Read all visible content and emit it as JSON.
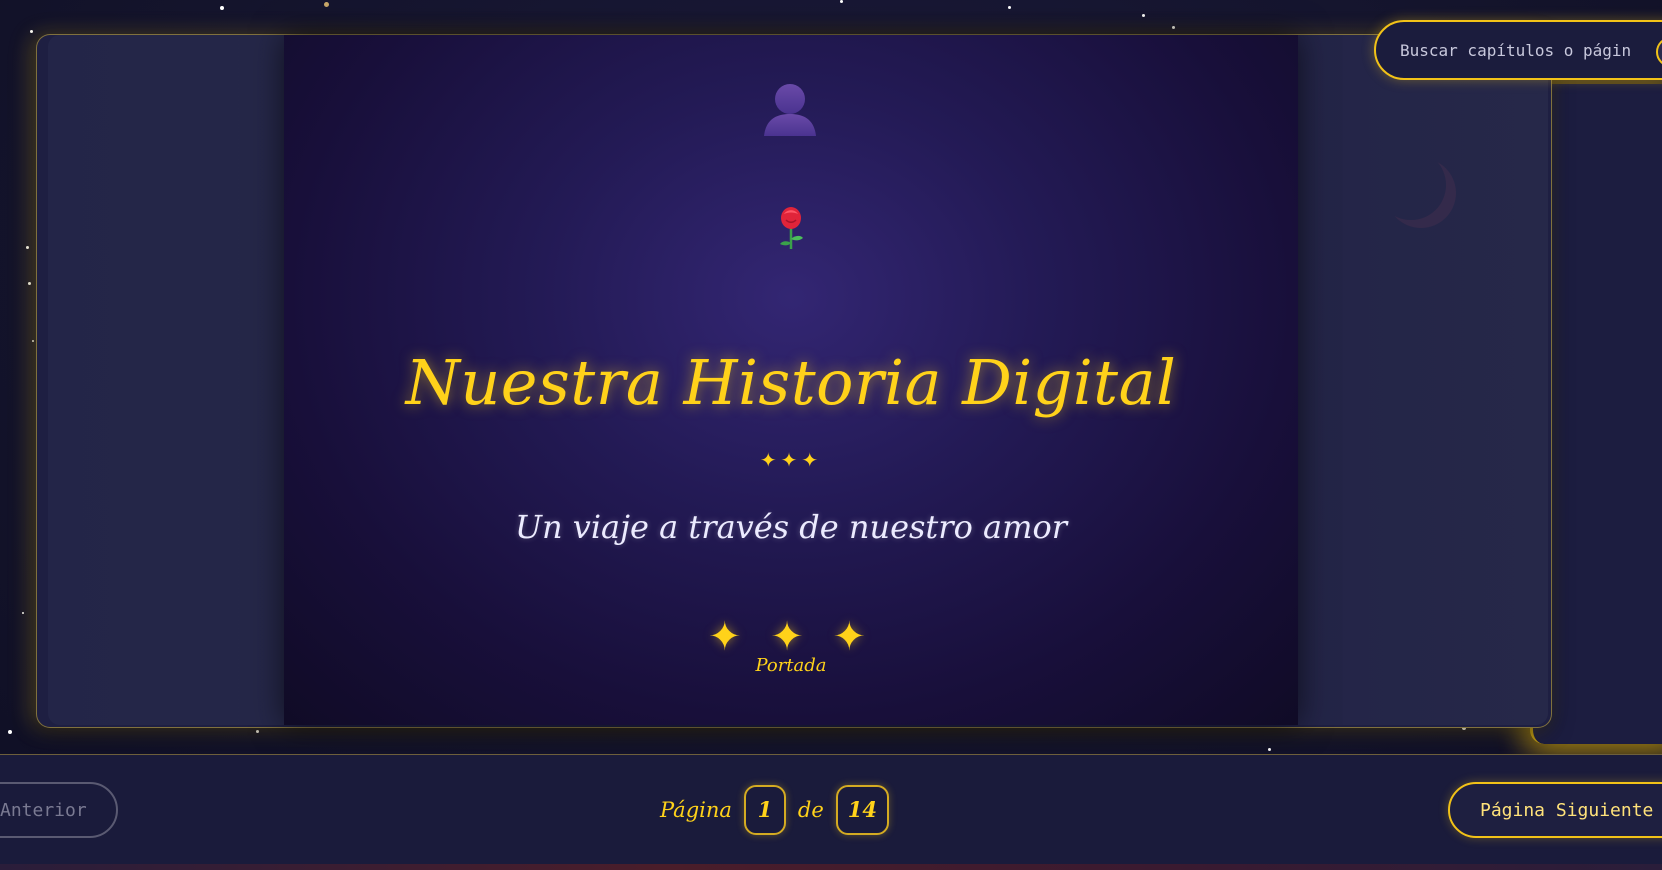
{
  "search": {
    "placeholder": "Buscar capítulos o página:"
  },
  "cover": {
    "avatar_icon": "person-silhouette-icon",
    "rose_icon": "rose-icon",
    "title": "Nuestra Historia Digital",
    "small_stars": "✦✦✦",
    "subtitle": "Un viaje a través de nuestro amor",
    "big_stars": "✦ ✦ ✦",
    "label": "Portada"
  },
  "navigation": {
    "prev_label": "Anterior",
    "next_label": "Página Siguiente",
    "page_word": "Página",
    "current_page": "1",
    "of_word": "de",
    "total_pages": "14"
  },
  "colors": {
    "accent_gold": "#ffd21a",
    "background": "#14142e",
    "cover_purple": "#2a1f62"
  }
}
